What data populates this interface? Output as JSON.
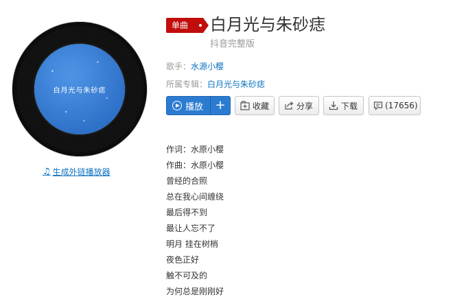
{
  "cover": {
    "text": "白月光与朱砂痣"
  },
  "generate_link": "生成外链播放器",
  "badge": "单曲",
  "title": "白月光与朱砂痣",
  "subtitle": "抖音完整版",
  "singer_label": "歌手：",
  "singer": "水源小樱",
  "album_label": "所属专辑：",
  "album": "白月光与朱砂痣",
  "buttons": {
    "play": "播放",
    "add": "+",
    "collect": "收藏",
    "share": "分享",
    "download": "下载",
    "comment": "(17656)"
  },
  "lyrics": [
    "作词：水原小樱",
    "作曲：水原小樱",
    "曾经的合照",
    "总在我心间缠绕",
    "最后得不到",
    "最让人忘不了",
    "明月 挂在树梢",
    "夜色正好",
    "触不可及的",
    "为何总是刚刚好"
  ],
  "colors": {
    "accent": "#c10d0c",
    "link": "#0c73c2",
    "play": "#2b7cd1"
  }
}
